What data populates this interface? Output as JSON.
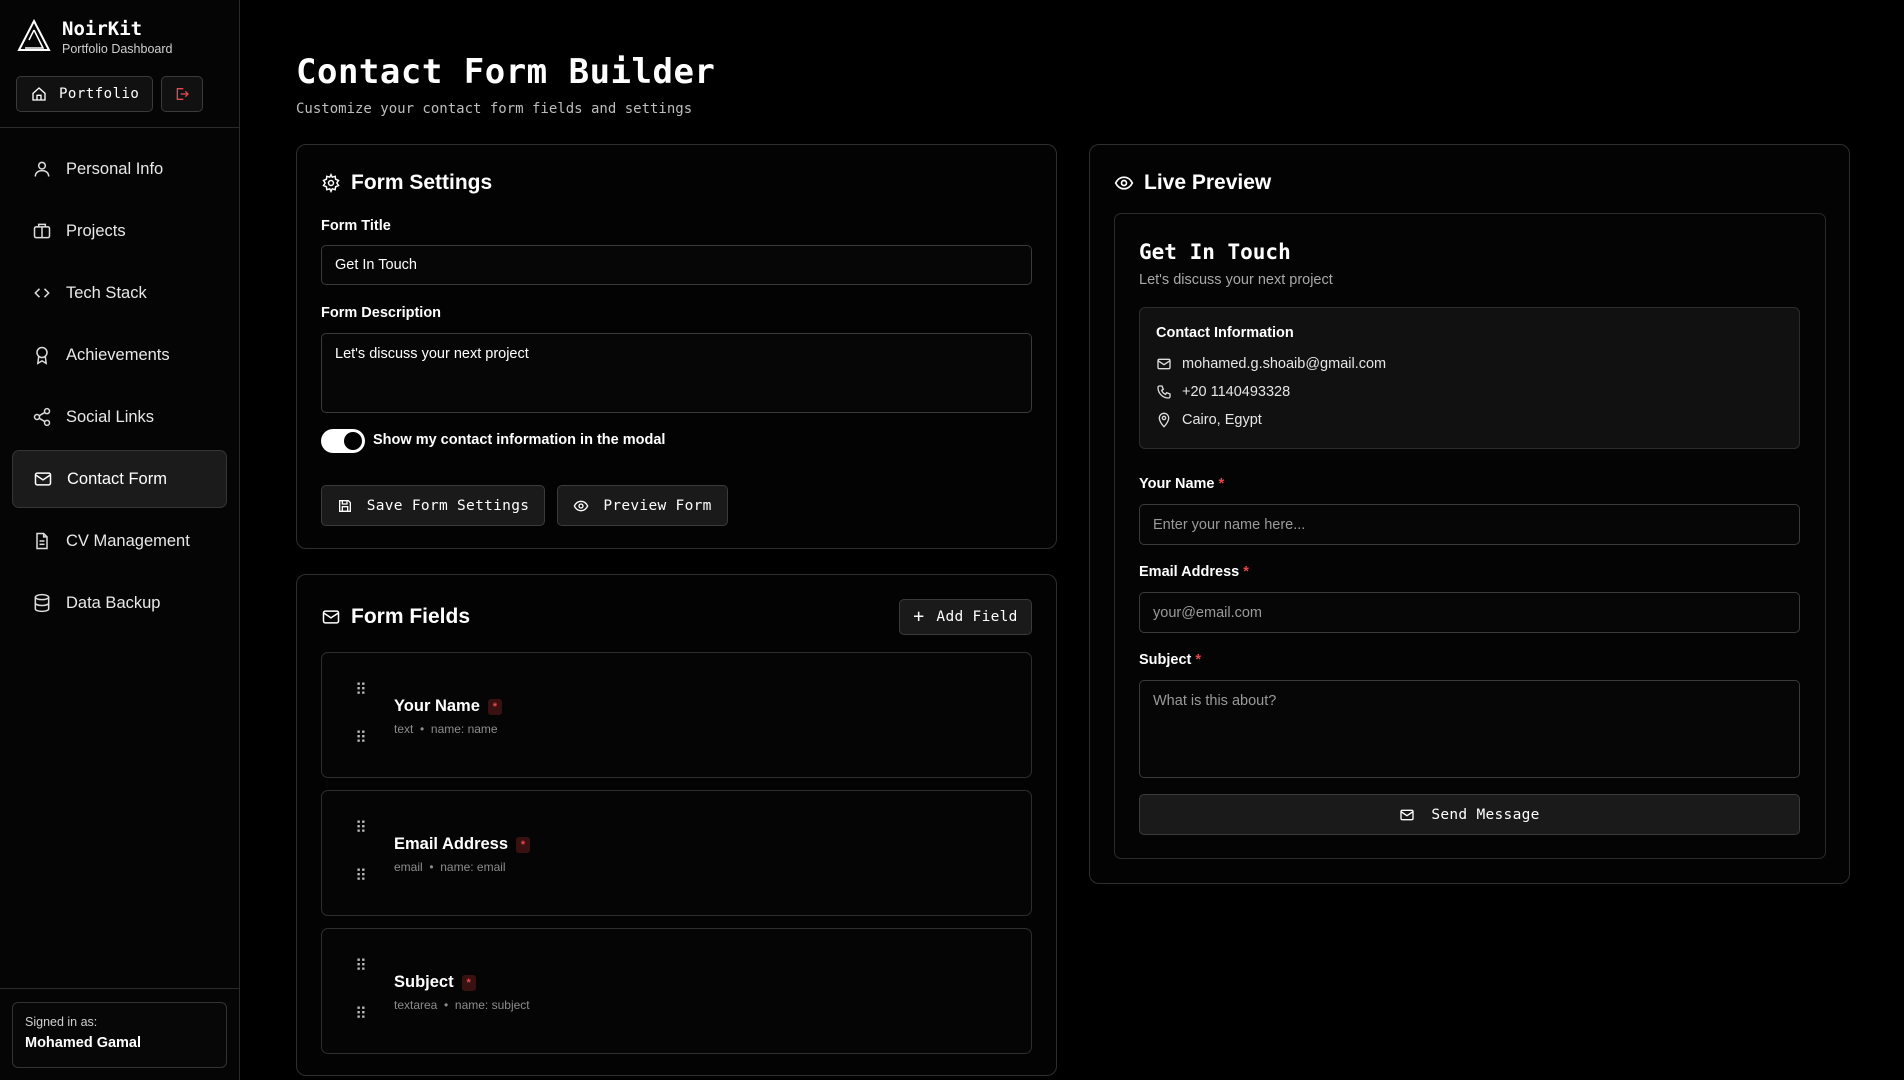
{
  "brand": {
    "name": "NoirKit",
    "subtitle": "Portfolio Dashboard"
  },
  "top_actions": {
    "portfolio_label": "Portfolio"
  },
  "nav": {
    "items": [
      {
        "label": "Personal Info",
        "icon": "user-icon",
        "active": false
      },
      {
        "label": "Projects",
        "icon": "briefcase-icon",
        "active": false
      },
      {
        "label": "Tech Stack",
        "icon": "code-icon",
        "active": false
      },
      {
        "label": "Achievements",
        "icon": "award-icon",
        "active": false
      },
      {
        "label": "Social Links",
        "icon": "share-icon",
        "active": false
      },
      {
        "label": "Contact Form",
        "icon": "mail-icon",
        "active": true
      },
      {
        "label": "CV Management",
        "icon": "file-icon",
        "active": false
      },
      {
        "label": "Data Backup",
        "icon": "database-icon",
        "active": false
      }
    ]
  },
  "user": {
    "signed_in_label": "Signed in as:",
    "name": "Mohamed Gamal"
  },
  "page": {
    "title": "Contact Form Builder",
    "subtitle": "Customize your contact form fields and settings"
  },
  "form_settings": {
    "title": "Form Settings",
    "form_title_label": "Form Title",
    "form_title_value": "Get In Touch",
    "form_description_label": "Form Description",
    "form_description_value": "Let's discuss your next project",
    "toggle_label": "Show my contact information in the modal",
    "toggle_on": true,
    "save_label": "Save Form Settings",
    "preview_label": "Preview Form"
  },
  "form_fields": {
    "title": "Form Fields",
    "add_label": "Add Field",
    "items": [
      {
        "label": "Your Name",
        "required_mark": "*",
        "type": "text",
        "sep": "•",
        "name": "name: name"
      },
      {
        "label": "Email Address",
        "required_mark": "*",
        "type": "email",
        "sep": "•",
        "name": "name: email"
      },
      {
        "label": "Subject",
        "required_mark": "*",
        "type": "textarea",
        "sep": "•",
        "name": "name: subject"
      }
    ]
  },
  "live_preview": {
    "title": "Live Preview",
    "form_title": "Get In Touch",
    "form_description": "Let's discuss your next project",
    "contact": {
      "heading": "Contact Information",
      "email": "mohamed.g.shoaib@gmail.com",
      "phone": "+20 1140493328",
      "location": "Cairo, Egypt"
    },
    "fields": [
      {
        "label": "Your Name",
        "required_mark": "*",
        "placeholder": "Enter your name here..."
      },
      {
        "label": "Email Address",
        "required_mark": "*",
        "placeholder": "your@email.com"
      },
      {
        "label": "Subject",
        "required_mark": "*",
        "placeholder": "What is this about?"
      }
    ],
    "send_label": "Send Message"
  },
  "colors": {
    "background": "#000000",
    "accent": "#ffffff",
    "required": "#e5484d",
    "logout": "#e5484d"
  }
}
